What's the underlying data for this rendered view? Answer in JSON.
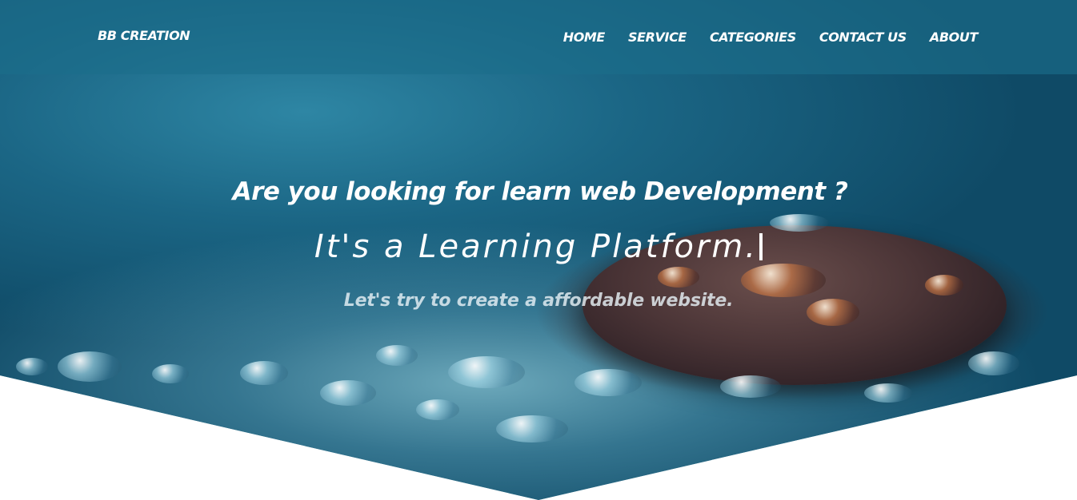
{
  "navbar": {
    "brand": "BB CREATION",
    "links": [
      "HOME",
      "SERVICE",
      "CATEGORIES",
      "CONTACT US",
      "ABOUT"
    ]
  },
  "hero": {
    "headline": "Are you looking for learn web Development ?",
    "typed_text": "It's a Learning Platform.",
    "tagline": "Let's try to create a affordable website.",
    "image_description_icon": "water-drops-stone-background"
  },
  "colors": {
    "nav_background": "#1c6e8a",
    "text": "#ffffff",
    "page_background": "#ffffff"
  }
}
